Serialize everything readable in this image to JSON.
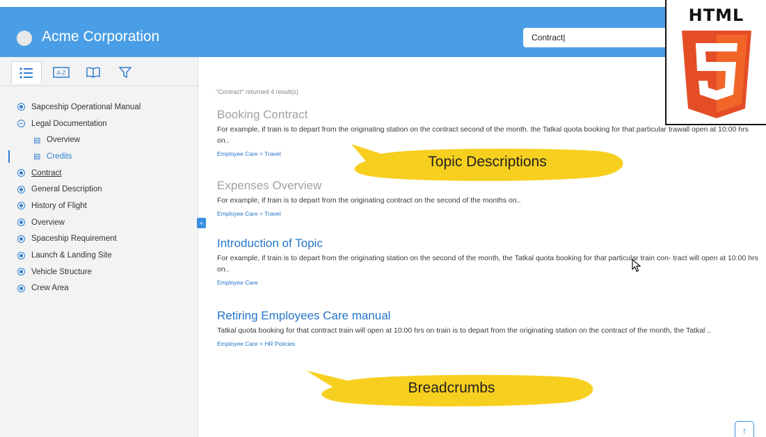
{
  "header": {
    "brand": "Acme Corporation",
    "search_value": "Contract|"
  },
  "badge": {
    "label": "HTML",
    "number": "5"
  },
  "sidebar": {
    "tabs": [
      {
        "icon": "toc-list-icon",
        "active": true
      },
      {
        "icon": "a-z-index-icon",
        "glyph": "A-Z",
        "active": false
      },
      {
        "icon": "glossary-book-icon",
        "active": false
      },
      {
        "icon": "filter-icon",
        "active": false
      }
    ],
    "tree": [
      {
        "label": "Sapceship Operational Manual",
        "state": "closed"
      },
      {
        "label": "Legal Documentation",
        "state": "open"
      },
      {
        "label": "Overview",
        "child": true
      },
      {
        "label": "Credits",
        "child": true,
        "selected": true
      },
      {
        "label": "Contract",
        "state": "closed",
        "current": true
      },
      {
        "label": "General Description",
        "state": "closed"
      },
      {
        "label": "History of Flight",
        "state": "closed"
      },
      {
        "label": "Overview",
        "state": "closed"
      },
      {
        "label": "Spaceship Requirement",
        "state": "closed"
      },
      {
        "label": "Launch & Landing Site",
        "state": "closed"
      },
      {
        "label": "Vehicle Structure",
        "state": "closed"
      },
      {
        "label": "Crew Area",
        "state": "closed"
      }
    ],
    "collapse_glyph": "«"
  },
  "results": {
    "summary": "\"Contract\" returned 4 result(s)",
    "items": [
      {
        "title": "Booking Contract",
        "visited": true,
        "description": "For example, if train is to depart from the originating station on the contract second of the month. the Tatkal quota booking for that particular trawall open at 10:00 hrs on..",
        "breadcrumb": "Employee Care > Travel"
      },
      {
        "title": "Expenses Overview",
        "visited": true,
        "description": "For example, if train is to depart from the originating contract on the second of the months on..",
        "breadcrumb": "Employee Care > Travel"
      },
      {
        "title": "Introduction of Topic",
        "visited": false,
        "description": "For example, if train is to depart from the originating station on the second of the month, the Tatkal quota booking for that particular train con- tract will open at 10:00 hrs on..",
        "breadcrumb": "Employee Care"
      },
      {
        "title": "Retiring Employees Care manual",
        "visited": false,
        "description": "Tatkal quota booking for that contract train will open at 10:00 hrs on train is to depart from the originating station on the contract of the month, the Tatkal ..",
        "breadcrumb": "Employee Care > HR Policies"
      }
    ]
  },
  "callouts": {
    "topic_descriptions": "Topic Descriptions",
    "breadcrumbs": "Breadcrumbs"
  },
  "scroll_top_glyph": "↑",
  "colors": {
    "header": "#4a9ee6",
    "link": "#2374c9",
    "callout": "#f7cf1f",
    "html5_orange": "#e44d26"
  }
}
